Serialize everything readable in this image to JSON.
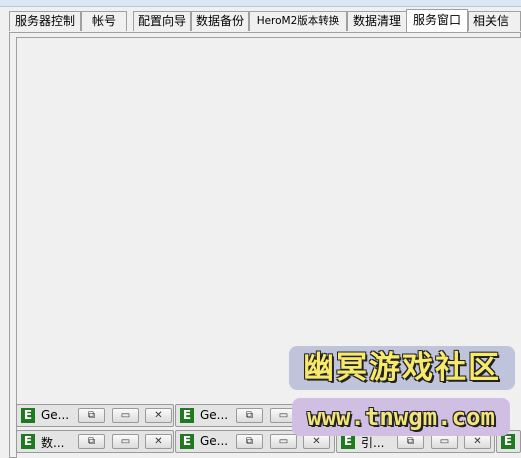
{
  "tabs": [
    {
      "label": "服务器控制"
    },
    {
      "label": "帐号"
    },
    {
      "label": "配置向导"
    },
    {
      "label": "数据备份"
    },
    {
      "label": "HeroM2版本转换"
    },
    {
      "label": "数据清理"
    },
    {
      "label": "服务窗口"
    },
    {
      "label": "相关信"
    }
  ],
  "active_tab": "服务窗口",
  "minimized_windows": [
    {
      "title": "Ge..."
    },
    {
      "title": "Ge..."
    },
    {
      "title": "数..."
    },
    {
      "title": "Ge..."
    },
    {
      "title": "引..."
    }
  ],
  "window_buttons": {
    "restore": "⧉",
    "maximize": "▭",
    "close": "✕"
  },
  "app_icon_letter": "E",
  "watermark": {
    "name": "幽冥游戏社区",
    "url": "www.tnwgm.com"
  },
  "colors": {
    "icon_green": "#1f7a1f",
    "watermark_yellow": "#f7e96a"
  }
}
